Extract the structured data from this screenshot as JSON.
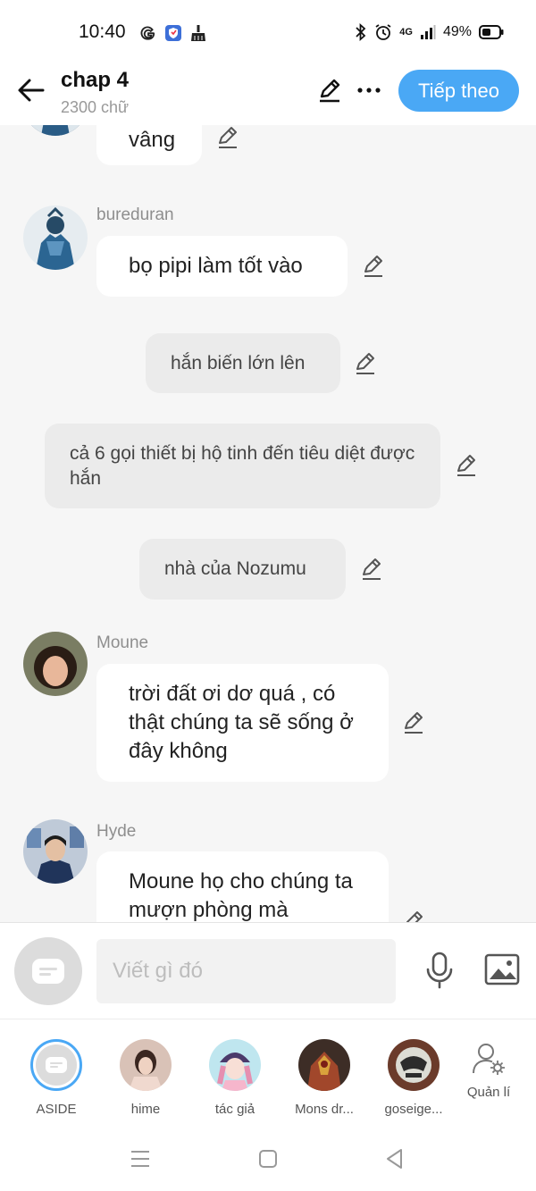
{
  "status_bar": {
    "time": "10:40",
    "network": "4G",
    "battery": "49%",
    "icons": [
      "google-icon",
      "shield-app-icon",
      "broom-icon",
      "bluetooth-icon",
      "alarm-icon",
      "signal-icon",
      "battery-icon"
    ]
  },
  "header": {
    "title": "chap 4",
    "word_count": "2300 chữ",
    "next_label": "Tiếp theo"
  },
  "messages": [
    {
      "type": "character",
      "sender": "",
      "text": "vâng"
    },
    {
      "type": "character",
      "sender": "bureduran",
      "text": "bọ pipi làm tốt vào"
    },
    {
      "type": "narration",
      "text": "hắn biến lớn lên"
    },
    {
      "type": "narration",
      "text": "cả 6 gọi thiết bị hộ tinh đến tiêu diệt được hắn"
    },
    {
      "type": "narration",
      "text": "nhà của Nozumu"
    },
    {
      "type": "character",
      "sender": "Moune",
      "text": "trời đất ơi dơ quá , có thật chúng ta sẽ sống ở đây không"
    },
    {
      "type": "character",
      "sender": "Hyde",
      "text": "Moune họ cho chúng ta mượn phòng mà"
    }
  ],
  "composer": {
    "placeholder": "Viết gì đó"
  },
  "characters": [
    {
      "name": "ASIDE",
      "active": true
    },
    {
      "name": "hime",
      "active": false
    },
    {
      "name": "tác giả",
      "active": false
    },
    {
      "name": "Mons dr...",
      "active": false
    },
    {
      "name": "goseige...",
      "active": false
    }
  ],
  "manage_label": "Quản lí",
  "colors": {
    "accent": "#4aa8f5",
    "background": "#f6f6f6",
    "bubble": "#ffffff",
    "narration_bubble": "#ebebeb"
  }
}
